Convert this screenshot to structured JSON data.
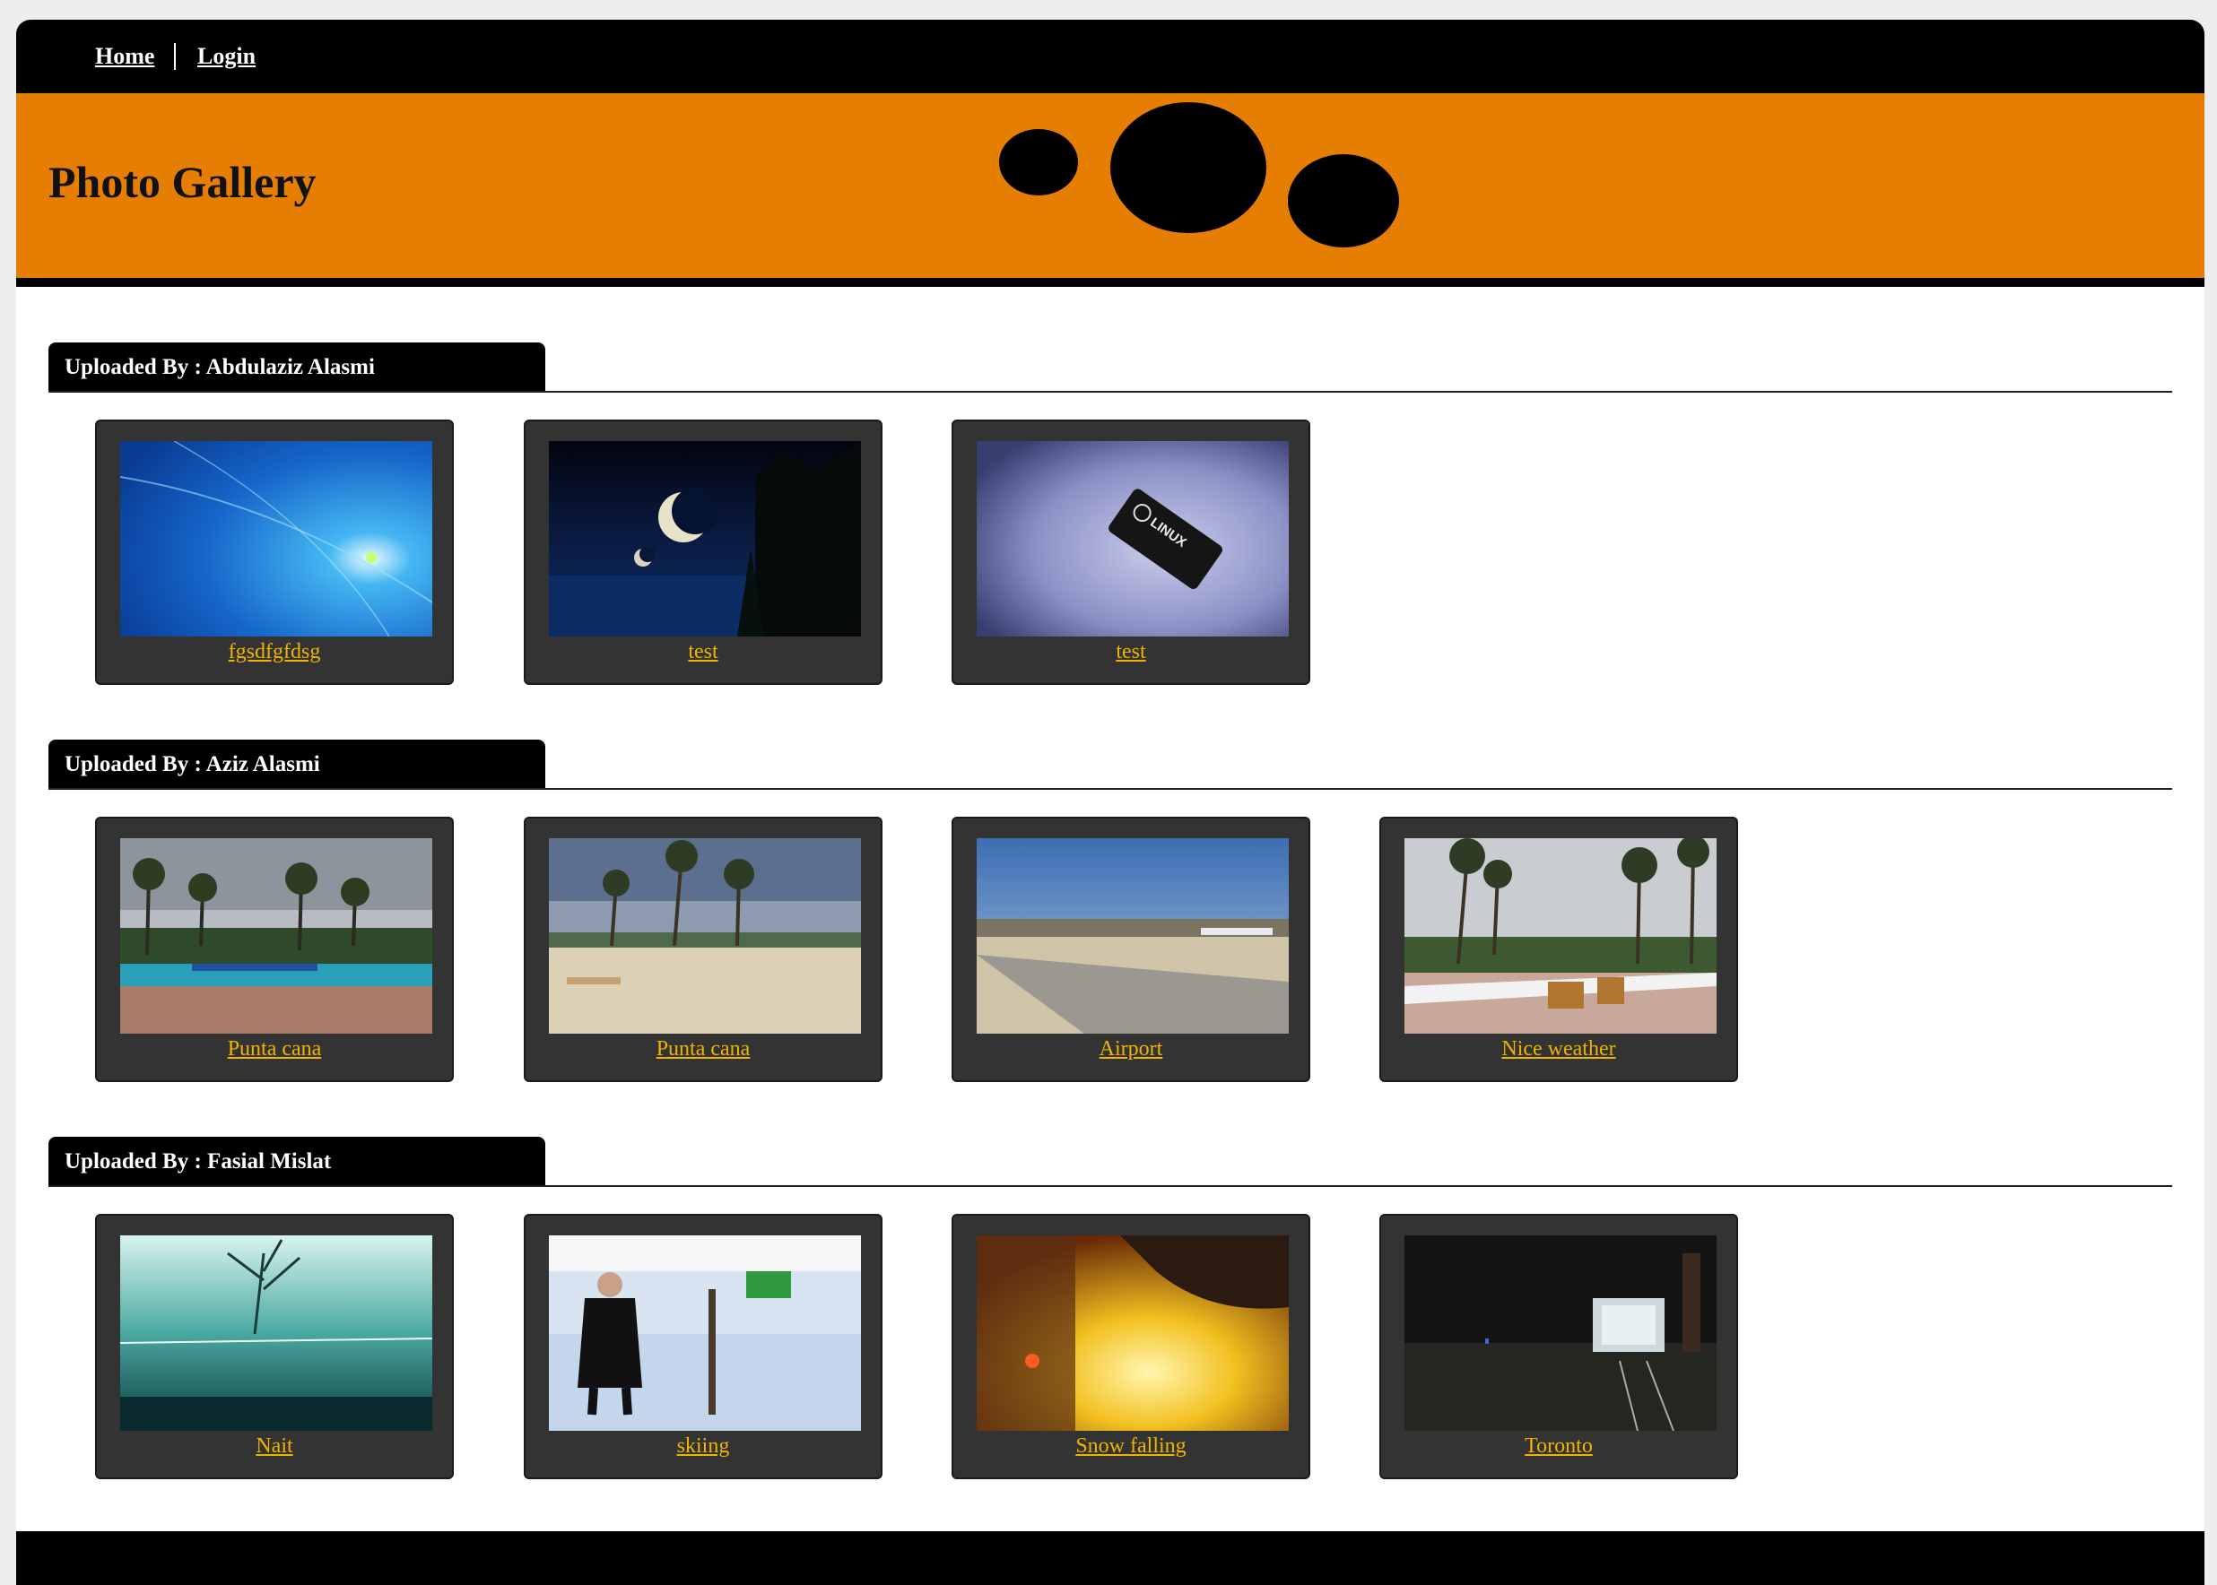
{
  "nav": {
    "home": "Home",
    "login": "Login"
  },
  "banner": {
    "title": "Photo Gallery"
  },
  "sections": [
    {
      "heading": "Uploaded By : Abdulaziz Alasmi",
      "photos": [
        {
          "caption": "fgsdfgfdsg"
        },
        {
          "caption": "test"
        },
        {
          "caption": "test"
        }
      ]
    },
    {
      "heading": "Uploaded By : Aziz Alasmi",
      "photos": [
        {
          "caption": "Punta cana"
        },
        {
          "caption": "Punta cana"
        },
        {
          "caption": "Airport"
        },
        {
          "caption": "Nice weather"
        }
      ]
    },
    {
      "heading": "Uploaded By : Fasial Mislat",
      "photos": [
        {
          "caption": "Nait"
        },
        {
          "caption": "skiing"
        },
        {
          "caption": "Snow falling"
        },
        {
          "caption": "Toronto"
        }
      ]
    }
  ],
  "chip_text": "LINUX",
  "colors": {
    "accent": "#e67e03",
    "caption": "#f0b400",
    "card": "#333333"
  }
}
